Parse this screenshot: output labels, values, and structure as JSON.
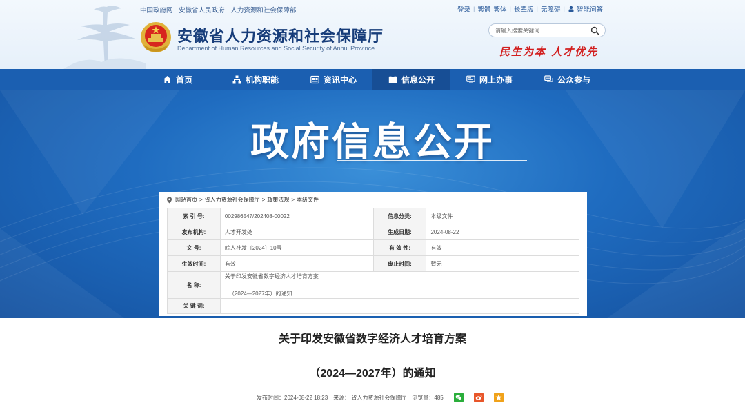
{
  "header": {
    "top_links": [
      "中国政府网",
      "安徽省人民政府",
      "人力资源和社会保障部"
    ],
    "utils": [
      "登录",
      "繁體",
      "繁体",
      "长辈版",
      "无障碍",
      "智能问答"
    ],
    "site_title": "安徽省人力资源和社会保障厅",
    "site_subtitle": "Department of Human Resources and Social Security of Anhui Province",
    "search_placeholder": "请输入搜索关键词",
    "slogan": "民生为本 人才优先"
  },
  "nav": {
    "items": [
      {
        "label": "首页",
        "icon": "home-icon"
      },
      {
        "label": "机构职能",
        "icon": "org-chart-icon"
      },
      {
        "label": "资讯中心",
        "icon": "news-icon"
      },
      {
        "label": "信息公开",
        "icon": "book-icon",
        "active": true
      },
      {
        "label": "网上办事",
        "icon": "monitor-icon"
      },
      {
        "label": "公众参与",
        "icon": "chat-icon"
      }
    ]
  },
  "banner": {
    "title": "政府信息公开"
  },
  "breadcrumb": [
    "网站首页",
    "省人力资源社会保障厅",
    "政策法规",
    "本级文件"
  ],
  "meta": {
    "index_label": "索 引 号:",
    "index_value": "002986547/202408-00022",
    "category_label": "信息分类:",
    "category_value": "本级文件",
    "publisher_label": "发布机构:",
    "publisher_value": "人才开发处",
    "date_label": "生成日期:",
    "date_value": "2024-08-22",
    "docno_label": "文 号:",
    "docno_value": "皖人社发〔2024〕10号",
    "valid_label": "有 效 性:",
    "valid_value": "有效",
    "effective_label": "生效时间:",
    "effective_value": "有效",
    "expire_label": "废止时间:",
    "expire_value": "暂无",
    "name_label": "名 称:",
    "name_line1": "关于印发安徽省数字经济人才培育方案",
    "name_line2": "（2024—2027年）的通知",
    "keyword_label": "关 键 词:",
    "keyword_value": ""
  },
  "article": {
    "title_line1": "关于印发安徽省数字经济人才培育方案",
    "title_line2": "（2024—2027年）的通知",
    "publish_time": "发布时间：2024-08-22 18:23",
    "source": "来源：  省人力资源社会保障厅",
    "views": "浏览量：485"
  },
  "colors": {
    "nav_bg": "#1b5fb1",
    "nav_active": "#174e95",
    "title_blue": "#173d7a",
    "slogan_red": "#d21e1e",
    "wechat": "#2aae3b",
    "weibo": "#e8562a",
    "favorite": "#f0a21a"
  }
}
